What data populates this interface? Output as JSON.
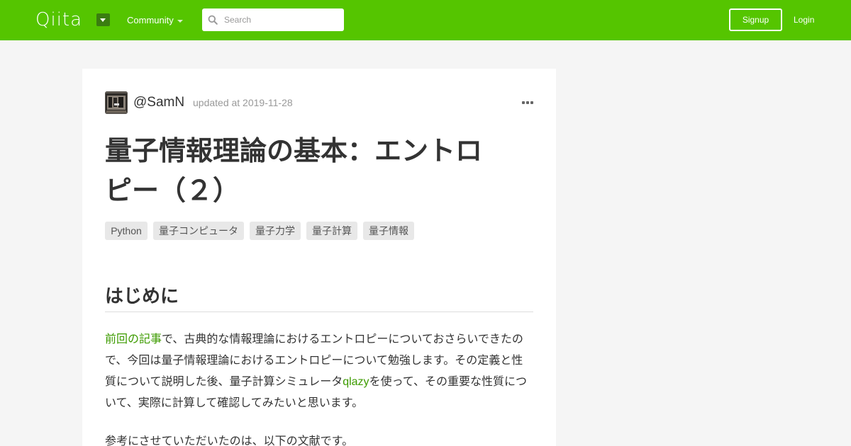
{
  "header": {
    "logo": "Qiita",
    "community_label": "Community",
    "search_placeholder": "Search",
    "signup_label": "Signup",
    "login_label": "Login",
    "brand_color": "#55c500"
  },
  "article": {
    "author": "@SamN",
    "updated": "updated at 2019-11-28",
    "title_line1": "量子情報理論の基本：エントロ",
    "title_line2": "ピー（２）",
    "tags": [
      "Python",
      "量子コンピュータ",
      "量子力学",
      "量子計算",
      "量子情報"
    ],
    "section_heading": "はじめに",
    "intro": {
      "link1": "前回の記事",
      "text1": "で、古典的な情報理論におけるエントロピーについておさらいできたので、今回は量子情報理論におけるエントロピーについて勉強します。その定義と性質について説明した後、量子計算シミュレータ",
      "link2": "qlazy",
      "text2": "を使って、その重要な性質について、実際に計算して確認してみたいと思います。"
    },
    "next_paragraph": "参考にさせていただいたのは、以下の文献です。"
  }
}
